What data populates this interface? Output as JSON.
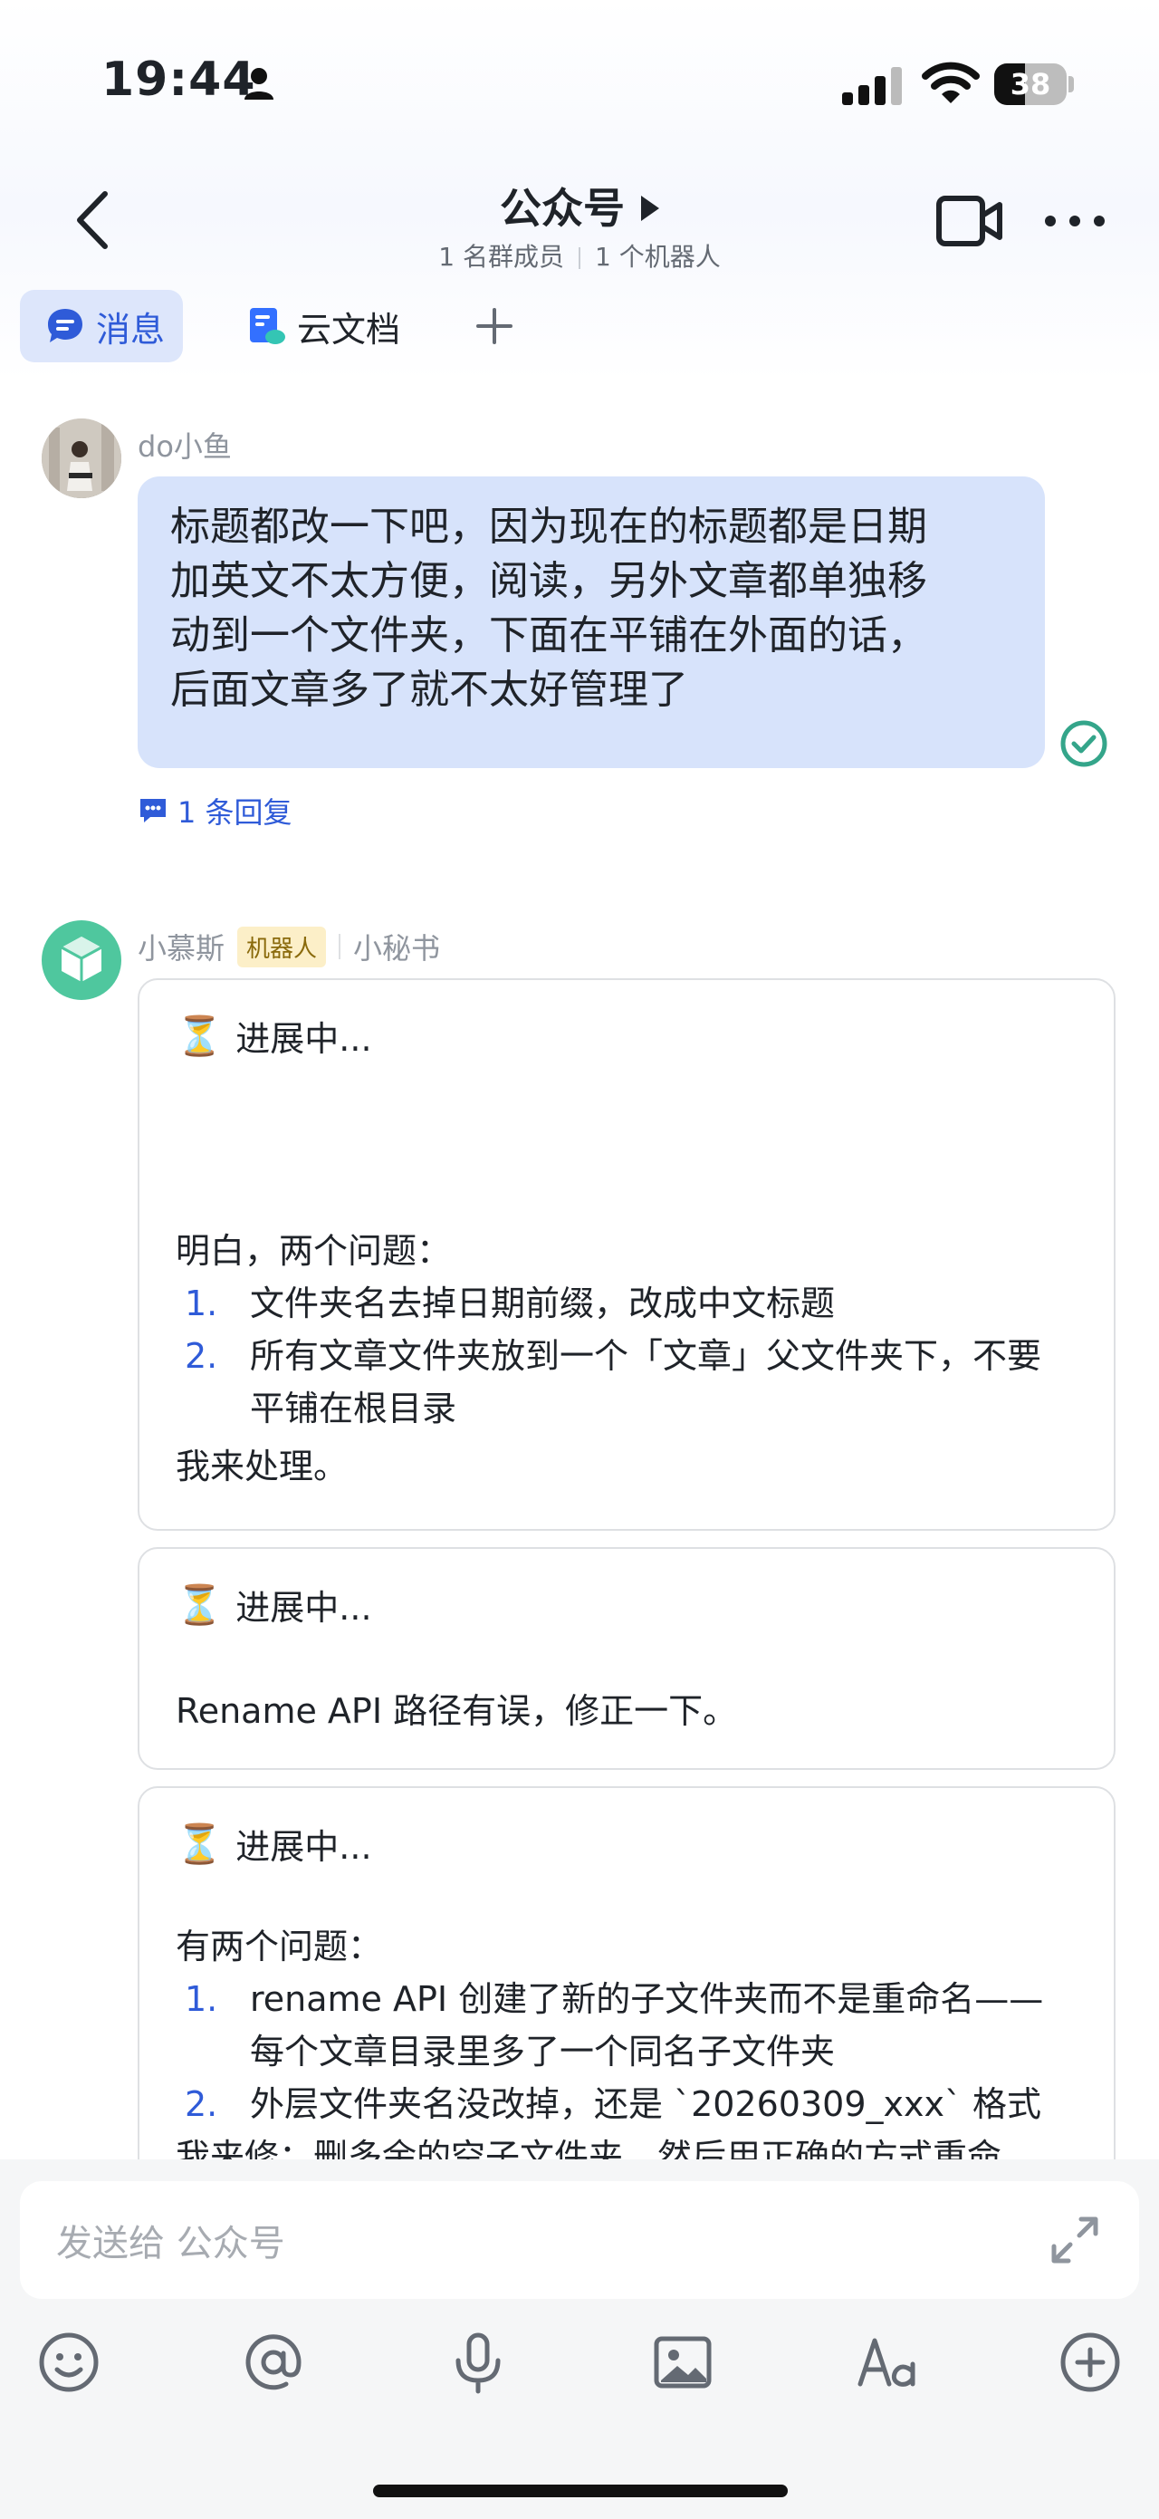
{
  "status_bar": {
    "time": "19:44",
    "battery": "38"
  },
  "header": {
    "title": "公众号",
    "members": "1 名群成员",
    "bots": "1 个机器人"
  },
  "tabs": [
    {
      "label": "消息"
    },
    {
      "label": "云文档"
    }
  ],
  "messages": {
    "user": {
      "name": "do小鱼",
      "text_lines": [
        "标题都改一下吧，因为现在的标题都是日期",
        "加英文不太方便，阅读，另外文章都单独移",
        "动到一个文件夹，下面在平铺在外面的话，",
        "后面文章多了就不太好管理了"
      ],
      "reply_count": "1 条回复"
    },
    "bot": {
      "name": "小慕斯",
      "badge": "机器人",
      "sub": "小秘书",
      "cards": [
        {
          "status": "进展中...",
          "intro": "明白，两个问题：",
          "items": [
            {
              "num": "1.",
              "lines": [
                "文件夹名去掉日期前缀，改成中文标题"
              ]
            },
            {
              "num": "2.",
              "lines": [
                "所有文章文件夹放到一个「文章」父文件夹下，不要",
                "平铺在根目录"
              ]
            }
          ],
          "outro": "我来处理。"
        },
        {
          "status": "进展中...",
          "text": "Rename API 路径有误，修正一下。"
        },
        {
          "status": "进展中...",
          "intro": "有两个问题：",
          "items": [
            {
              "num": "1.",
              "lines": [
                "rename API 创建了新的子文件夹而不是重命名——",
                "每个文章目录里多了一个同名子文件夹"
              ]
            },
            {
              "num": "2.",
              "lines": [
                "外层文件夹名没改掉，还是 `20260309_xxx` 格式"
              ]
            }
          ],
          "cut_line": "我来修：删多余的空子文件夹，然后用正确的方式重命"
        }
      ]
    }
  },
  "composer": {
    "placeholder": "发送给 公众号"
  }
}
